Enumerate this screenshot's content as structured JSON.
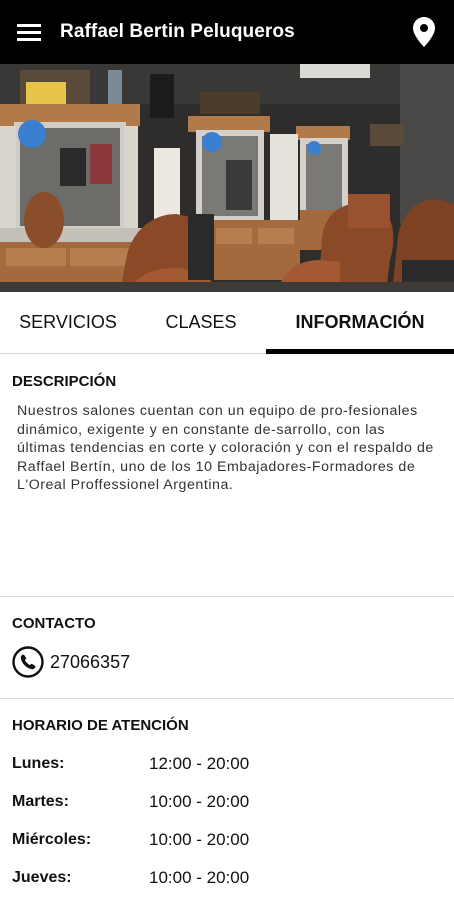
{
  "header": {
    "title": "Raffael Bertin Peluqueros",
    "menu_icon": "hamburger-menu-icon",
    "location_icon": "map-pin-icon"
  },
  "hero": {
    "description_image": "barbershop-interior-photo"
  },
  "tabs": [
    {
      "label": "SERVICIOS",
      "active": false
    },
    {
      "label": "CLASES",
      "active": false
    },
    {
      "label": "INFORMACIÓN",
      "active": true
    }
  ],
  "description": {
    "heading": "DESCRIPCIÓN",
    "text": "Nuestros salones cuentan con un equipo de pro-fesionales dinámico, exigente y en constante de-sarrollo, con las últimas tendencias en corte y coloración y con el respaldo de Raffael Bertín, uno de los 10 Embajadores-Formadores de L'Oreal Proffessionel Argentina."
  },
  "contact": {
    "heading": "CONTACTO",
    "phone": "27066357",
    "phone_icon": "phone-icon"
  },
  "hours": {
    "heading": "HORARIO DE ATENCIÓN",
    "rows": [
      {
        "day": "Lunes:",
        "time": "12:00 - 20:00"
      },
      {
        "day": "Martes:",
        "time": "10:00 - 20:00"
      },
      {
        "day": "Miércoles:",
        "time": "10:00 - 20:00"
      },
      {
        "day": "Jueves:",
        "time": "10:00 - 20:00"
      }
    ]
  },
  "colors": {
    "appbar": "#000000",
    "tab_indicator": "#000000",
    "text": "#111111"
  }
}
